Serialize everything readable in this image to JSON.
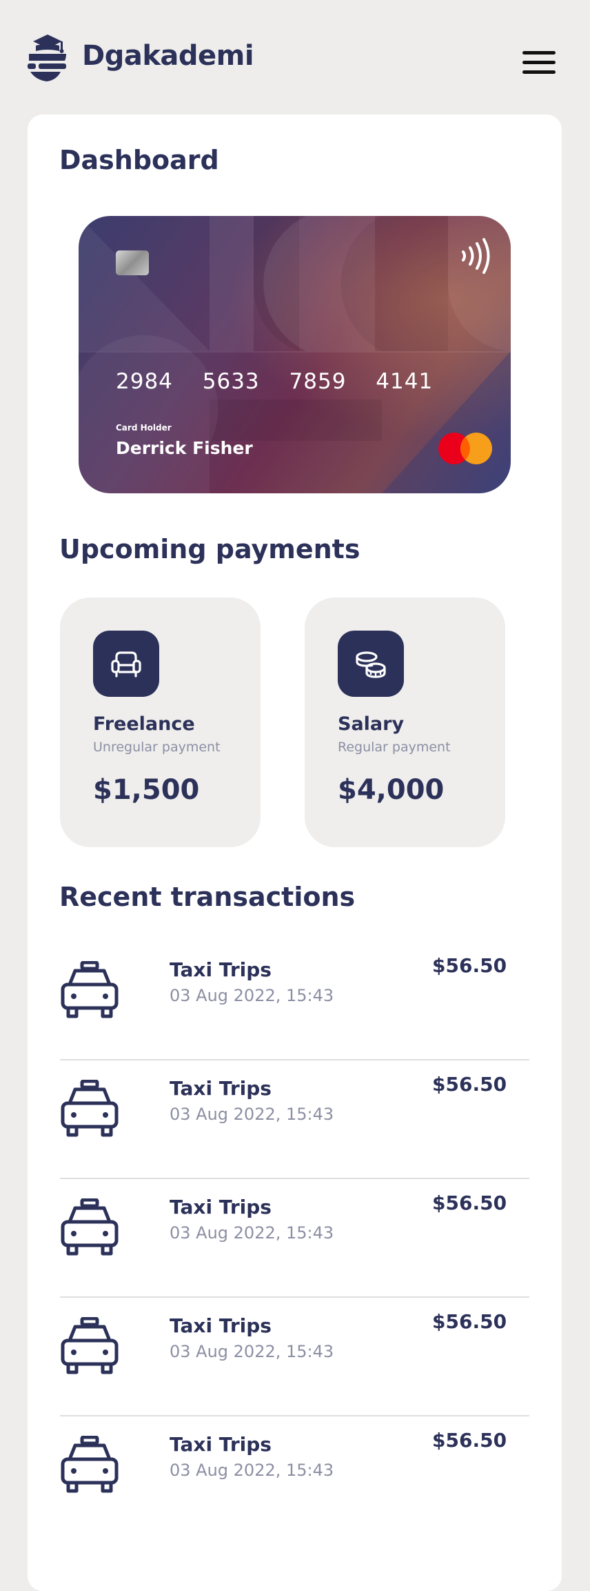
{
  "header": {
    "brand": "Dgakademi",
    "menu_icon": "hamburger-menu-icon"
  },
  "dashboard": {
    "title": "Dashboard",
    "card": {
      "number_groups": [
        "2984",
        "5633",
        "7859",
        "4141"
      ],
      "holder_label": "Card Holder",
      "holder_name": "Derrick Fisher",
      "network": "mastercard"
    }
  },
  "upcoming": {
    "title": "Upcoming payments",
    "items": [
      {
        "icon": "armchair-icon",
        "name": "Freelance",
        "subtitle": "Unregular payment",
        "amount": "$1,500"
      },
      {
        "icon": "coins-icon",
        "name": "Salary",
        "subtitle": "Regular payment",
        "amount": "$4,000"
      }
    ]
  },
  "recent": {
    "title": "Recent transactions",
    "items": [
      {
        "icon": "taxi-icon",
        "name": "Taxi Trips",
        "date": "03 Aug 2022, 15:43",
        "amount": "$56.50"
      },
      {
        "icon": "taxi-icon",
        "name": "Taxi Trips",
        "date": "03 Aug 2022, 15:43",
        "amount": "$56.50"
      },
      {
        "icon": "taxi-icon",
        "name": "Taxi Trips",
        "date": "03 Aug 2022, 15:43",
        "amount": "$56.50"
      },
      {
        "icon": "taxi-icon",
        "name": "Taxi Trips",
        "date": "03 Aug 2022, 15:43",
        "amount": "$56.50"
      },
      {
        "icon": "taxi-icon",
        "name": "Taxi Trips",
        "date": "03 Aug 2022, 15:43",
        "amount": "$56.50"
      }
    ]
  },
  "colors": {
    "primary": "#2c3159",
    "muted": "#8c8fa3",
    "background": "#eeedec",
    "surface": "#ffffff"
  }
}
